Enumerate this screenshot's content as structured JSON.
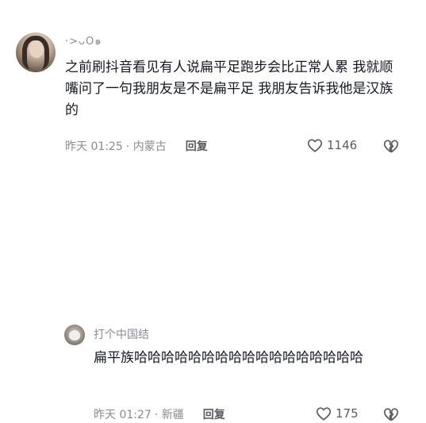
{
  "comments": [
    {
      "username": "·>ᴗO๑",
      "text": "之前刷抖音看见有人说扁平足跑步会比正常人累 我就顺嘴问了一句我朋友是不是扁平足 我朋友告诉我他是汉族的",
      "time": "昨天 01:25",
      "location": "· 内蒙古",
      "reply_label": "回复",
      "likes": "1146"
    },
    {
      "username": "打个中国结",
      "text": "扁平族哈哈哈哈哈哈哈哈哈哈哈哈哈哈哈哈哈",
      "time": "昨天 01:27",
      "location": "· 新疆",
      "reply_label": "回复",
      "likes": "175"
    }
  ],
  "icons": {
    "like": "heart-outline-icon",
    "dislike": "broken-heart-icon"
  }
}
